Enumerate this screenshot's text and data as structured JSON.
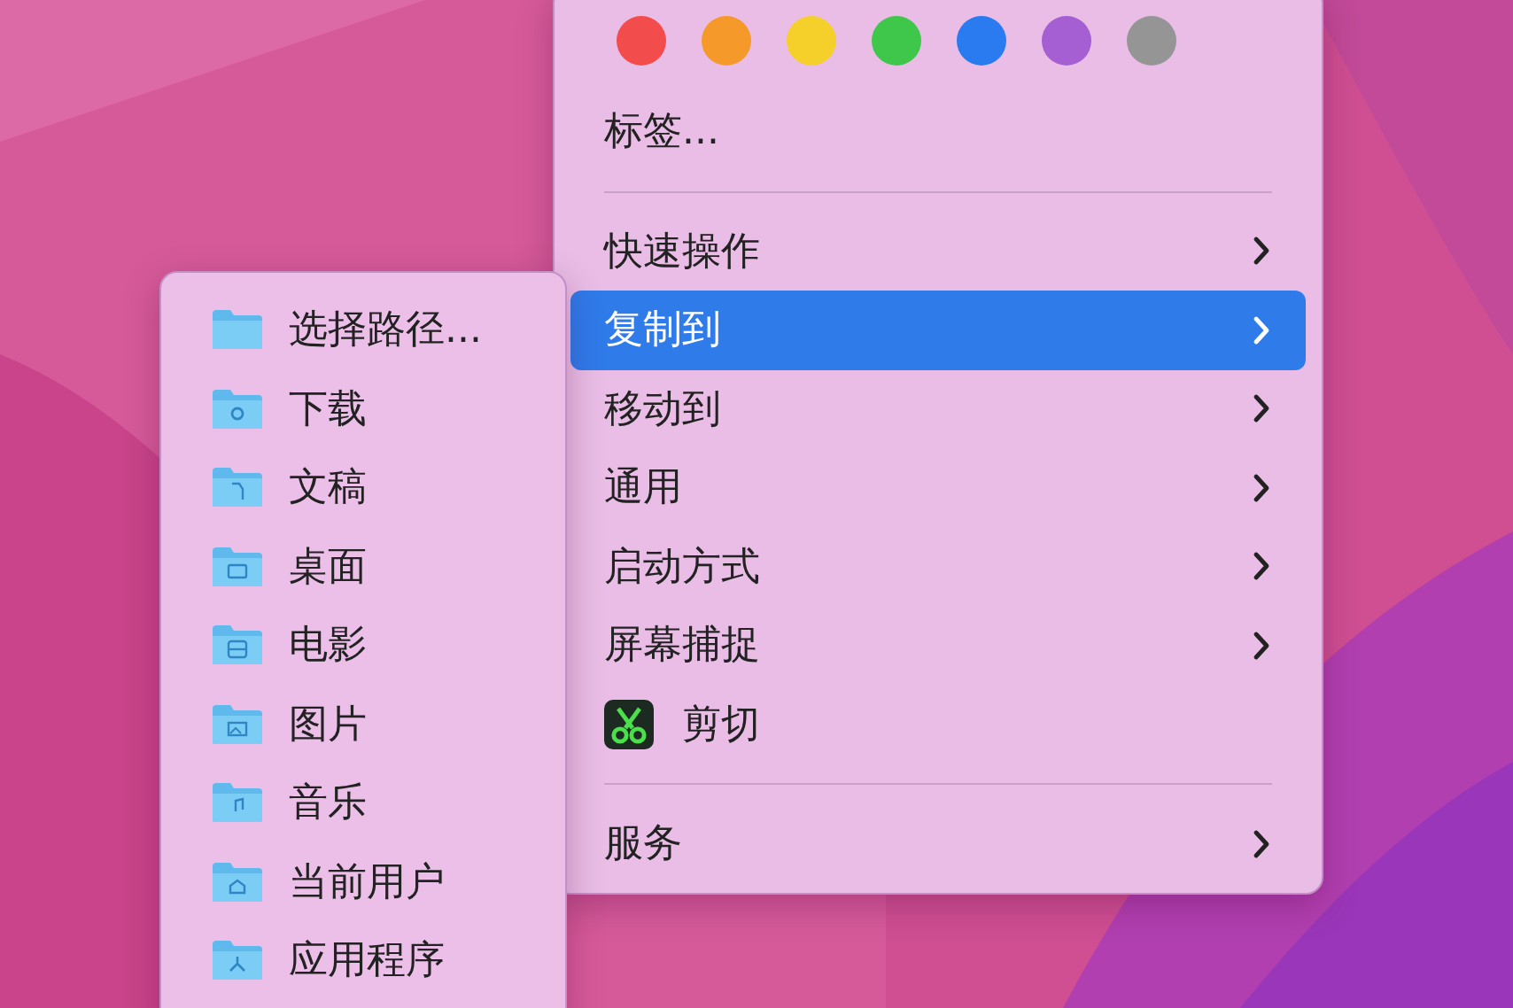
{
  "main_menu": {
    "tag_colors": [
      {
        "color": "#f24c4c"
      },
      {
        "color": "#f59a2a"
      },
      {
        "color": "#f6d02a"
      },
      {
        "color": "#3ec74a"
      },
      {
        "color": "#2a7bf0"
      },
      {
        "color": "#a55fd2"
      },
      {
        "color": "#959595"
      }
    ],
    "tags_label": "标签...",
    "groups": [
      [
        {
          "label": "快速操作",
          "kind": "submenu",
          "selected": false
        },
        {
          "label": "复制到",
          "kind": "submenu",
          "selected": true
        },
        {
          "label": "移动到",
          "kind": "submenu",
          "selected": false
        },
        {
          "label": "通用",
          "kind": "submenu",
          "selected": false
        },
        {
          "label": "启动方式",
          "kind": "submenu",
          "selected": false
        },
        {
          "label": "屏幕捕捉",
          "kind": "submenu",
          "selected": false
        },
        {
          "label": "剪切",
          "kind": "action",
          "selected": false
        }
      ],
      [
        {
          "label": "服务",
          "kind": "submenu",
          "selected": false
        }
      ]
    ]
  },
  "submenu": {
    "items": [
      {
        "label": "选择路径..."
      },
      {
        "label": "下载"
      },
      {
        "label": "文稿"
      },
      {
        "label": "桌面"
      },
      {
        "label": "电影"
      },
      {
        "label": "图片"
      },
      {
        "label": "音乐"
      },
      {
        "label": "当前用户"
      },
      {
        "label": "应用程序"
      }
    ]
  }
}
